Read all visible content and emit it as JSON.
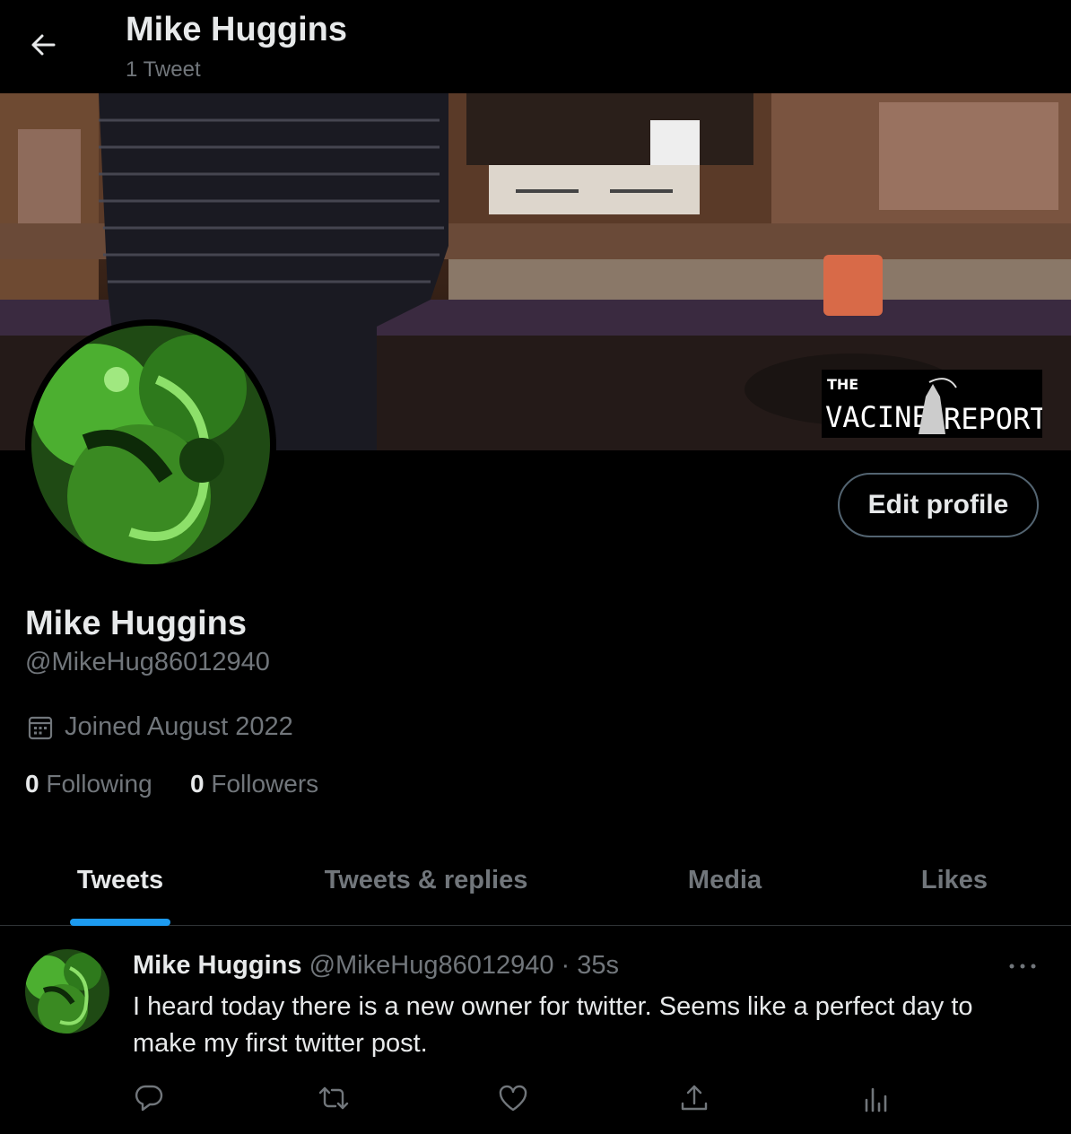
{
  "header": {
    "name": "Mike Huggins",
    "tweet_count": "1 Tweet"
  },
  "banner": {
    "logo_text_top": "THE",
    "logo_text_left": "VACINE",
    "logo_text_right": "REPORT"
  },
  "profile": {
    "edit_label": "Edit profile",
    "name": "Mike Huggins",
    "handle": "@MikeHug86012940",
    "joined": "Joined August 2022",
    "following_count": "0",
    "following_label": "Following",
    "followers_count": "0",
    "followers_label": "Followers"
  },
  "tabs": [
    {
      "label": "Tweets"
    },
    {
      "label": "Tweets & replies"
    },
    {
      "label": "Media"
    },
    {
      "label": "Likes"
    }
  ],
  "tweet": {
    "name": "Mike Huggins",
    "handle": "@MikeHug86012940",
    "separator": "·",
    "time": "35s",
    "text": "I heard today there is a new owner for twitter. Seems like a perfect day to make my first twitter post."
  },
  "colors": {
    "accent": "#1d9bf0",
    "muted": "#71767b",
    "text": "#e7e9ea",
    "avatar_green": "#4caf30"
  },
  "icons": [
    "back-arrow-icon",
    "calendar-icon",
    "more-icon",
    "reply-icon",
    "retweet-icon",
    "like-icon",
    "share-icon",
    "analytics-icon"
  ]
}
